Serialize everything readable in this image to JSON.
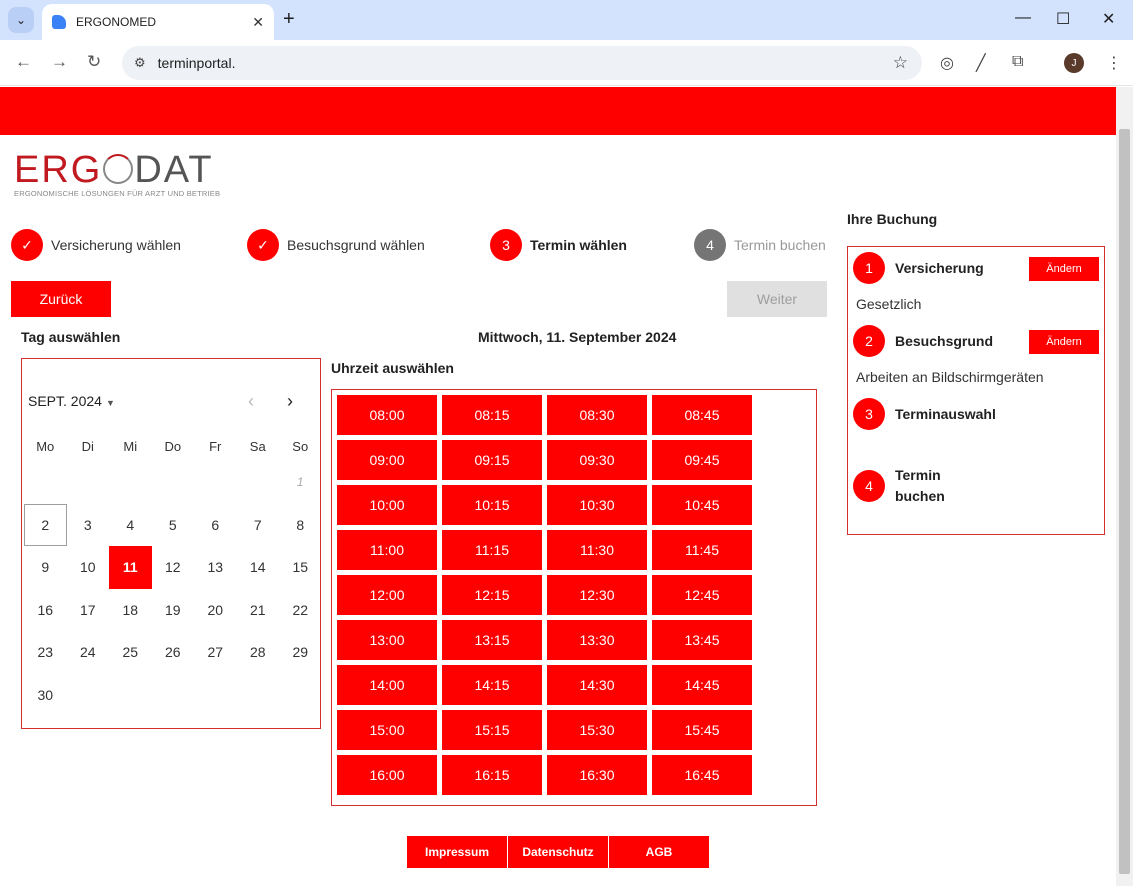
{
  "browser": {
    "tab_title": "ERGONOMED",
    "url": "terminportal."
  },
  "brand": {
    "accent": "#ff0000",
    "logo_left": "ERG",
    "logo_right": "DAT",
    "logo_tagline": "ERGONOMISCHE LÖSUNGEN FÜR ARZT UND BETRIEB"
  },
  "steps": [
    {
      "marker": "✓",
      "label": "Versicherung wählen",
      "state": "done"
    },
    {
      "marker": "✓",
      "label": "Besuchsgrund wählen",
      "state": "done"
    },
    {
      "marker": "3",
      "label": "Termin wählen",
      "state": "active"
    },
    {
      "marker": "4",
      "label": "Termin buchen",
      "state": "pending"
    }
  ],
  "buttons": {
    "back": "Zurück",
    "next": "Weiter"
  },
  "calendar": {
    "title": "Tag auswählen",
    "month": "SEPT. 2024",
    "weekdays": [
      "Mo",
      "Di",
      "Mi",
      "Do",
      "Fr",
      "Sa",
      "So"
    ],
    "rows": [
      [
        "",
        "",
        "",
        "",
        "",
        "",
        "1"
      ],
      [
        "2",
        "3",
        "4",
        "5",
        "6",
        "7",
        "8"
      ],
      [
        "9",
        "10",
        "11",
        "12",
        "13",
        "14",
        "15"
      ],
      [
        "16",
        "17",
        "18",
        "19",
        "20",
        "21",
        "22"
      ],
      [
        "23",
        "24",
        "25",
        "26",
        "27",
        "28",
        "29"
      ],
      [
        "30",
        "",
        "",
        "",
        "",
        "",
        ""
      ]
    ],
    "muted_day": "1",
    "today": "2",
    "selected": "11"
  },
  "selected_date": "Mittwoch, 11. September 2024",
  "times": {
    "title": "Uhrzeit auswählen",
    "slots": [
      "08:00",
      "08:15",
      "08:30",
      "08:45",
      "09:00",
      "09:15",
      "09:30",
      "09:45",
      "10:00",
      "10:15",
      "10:30",
      "10:45",
      "11:00",
      "11:15",
      "11:30",
      "11:45",
      "12:00",
      "12:15",
      "12:30",
      "12:45",
      "13:00",
      "13:15",
      "13:30",
      "13:45",
      "14:00",
      "14:15",
      "14:30",
      "14:45",
      "15:00",
      "15:15",
      "15:30",
      "15:45",
      "16:00",
      "16:15",
      "16:30",
      "16:45"
    ]
  },
  "summary": {
    "title": "Ihre Buchung",
    "change_label": "Ändern",
    "items": [
      {
        "number": "1",
        "label": "Versicherung",
        "value": "Gesetzlich"
      },
      {
        "number": "2",
        "label": "Besuchsgrund",
        "value": "Arbeiten an Bildschirmgeräten"
      },
      {
        "number": "3",
        "label": "Terminauswahl",
        "value": ""
      },
      {
        "number": "4",
        "label_line1": "Termin",
        "label_line2": "buchen"
      }
    ]
  },
  "footer": [
    "Impressum",
    "Datenschutz",
    "AGB"
  ]
}
